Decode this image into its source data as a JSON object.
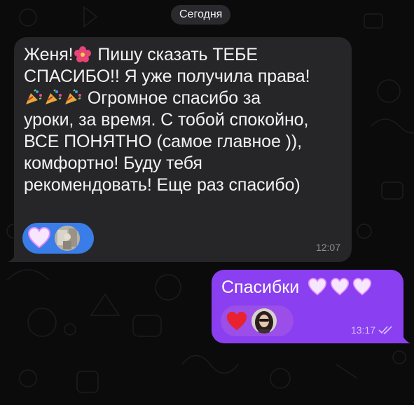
{
  "chat": {
    "date_separator": "Сегодня",
    "incoming_message": {
      "line1_a": "Женя!",
      "line1_b": "  Пишу сказать ТЕБЕ",
      "line2": "СПАСИБО!!  Я уже получила права!",
      "line3_b": " Огромное спасибо за",
      "line4": "уроки, за время. С тобой спокойно,",
      "line5": "ВСЕ ПОНЯТНО (самое главное )),",
      "line6": "комфортно! Буду тебя",
      "line7": "рекомендовать! Еще раз спасибо)",
      "time": "12:07",
      "reaction_emoji": "white-heart"
    },
    "outgoing_message": {
      "text": "Спасибки",
      "time": "13:17",
      "status": "read",
      "reaction_emoji": "red-heart"
    }
  },
  "colors": {
    "background": "#0b0b0c",
    "incoming_bubble": "#262628",
    "outgoing_bubble": "#8a3ff0",
    "incoming_reaction": "#3a7de8",
    "outgoing_reaction": "#9b4fe8"
  },
  "icons": [
    "hibiscus-icon",
    "party-popper-icon",
    "white-heart-icon",
    "red-heart-icon",
    "double-check-icon"
  ]
}
